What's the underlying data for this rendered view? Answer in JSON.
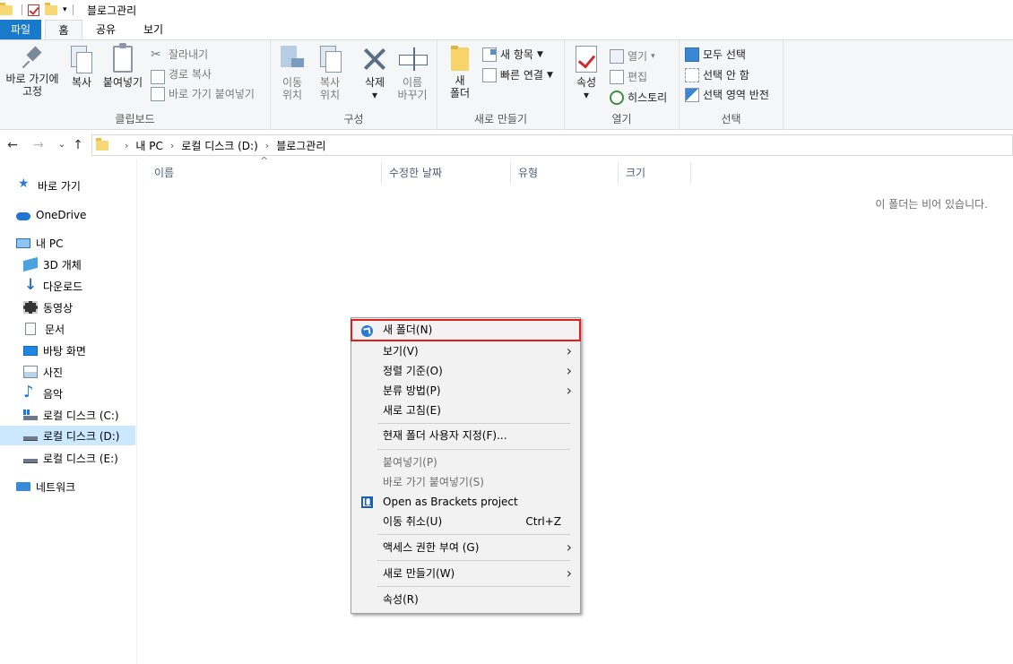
{
  "window": {
    "title": "블로그관리"
  },
  "tabs": {
    "file": "파일",
    "home": "홈",
    "share": "공유",
    "view": "보기"
  },
  "ribbon": {
    "clipboard": {
      "label": "클립보드",
      "pin_line1": "바로 가기에",
      "pin_line2": "고정",
      "copy": "복사",
      "paste": "붙여넣기",
      "cut": "잘라내기",
      "copy_path": "경로 복사",
      "paste_shortcut": "바로 가기 붙여넣기"
    },
    "organize": {
      "label": "구성",
      "move_line1": "이동",
      "move_line2": "위치",
      "copy_line1": "복사",
      "copy_line2": "위치",
      "delete": "삭제",
      "rename_line1": "이름",
      "rename_line2": "바꾸기"
    },
    "new": {
      "label": "새로 만들기",
      "new_folder_line1": "새",
      "new_folder_line2": "폴더",
      "new_item": "새 항목",
      "easy_access": "빠른 연결"
    },
    "open": {
      "label": "열기",
      "properties": "속성",
      "open": "열기",
      "edit": "편집",
      "history": "히스토리"
    },
    "select": {
      "label": "선택",
      "select_all": "모두 선택",
      "select_none": "선택 안 함",
      "invert": "선택 영역 반전"
    }
  },
  "address": {
    "crumbs": [
      "내 PC",
      "로컬 디스크 (D:)",
      "블로그관리"
    ]
  },
  "sidebar": {
    "items": [
      {
        "label": "바로 가기",
        "icon": "star-icon"
      },
      {
        "label": "OneDrive",
        "icon": "cloud-icon"
      },
      {
        "label": "내 PC",
        "icon": "computer-icon"
      },
      {
        "label": "3D 개체",
        "icon": "cube-icon"
      },
      {
        "label": "다운로드",
        "icon": "download-icon"
      },
      {
        "label": "동영상",
        "icon": "video-icon"
      },
      {
        "label": "문서",
        "icon": "document-icon"
      },
      {
        "label": "바탕 화면",
        "icon": "desktop-icon"
      },
      {
        "label": "사진",
        "icon": "picture-icon"
      },
      {
        "label": "음악",
        "icon": "music-icon"
      },
      {
        "label": "로컬 디스크 (C:)",
        "icon": "drive-icon"
      },
      {
        "label": "로컬 디스크 (D:)",
        "icon": "drive-icon",
        "selected": true
      },
      {
        "label": "로컬 디스크 (E:)",
        "icon": "drive-icon"
      },
      {
        "label": "네트워크",
        "icon": "network-icon"
      }
    ]
  },
  "columns": [
    "이름",
    "수정한 날짜",
    "유형",
    "크기"
  ],
  "empty_message": "이 폴더는 비어 있습니다.",
  "context_menu": {
    "items": [
      {
        "label": "새 폴더(N)",
        "highlighted": true,
        "icon": "new-folder-icon"
      },
      {
        "label": "보기(V)",
        "submenu": true
      },
      {
        "label": "정렬 기준(O)",
        "submenu": true
      },
      {
        "label": "분류 방법(P)",
        "submenu": true
      },
      {
        "label": "새로 고침(E)"
      },
      {
        "label": "현재 폴더 사용자 지정(F)..."
      },
      {
        "label": "붙여넣기(P)",
        "disabled": true
      },
      {
        "label": "바로 가기 붙여넣기(S)",
        "disabled": true
      },
      {
        "label": "Open as Brackets project",
        "icon": "brackets-icon"
      },
      {
        "label": "이동 취소(U)",
        "shortcut": "Ctrl+Z"
      },
      {
        "label": "액세스 권한 부여 (G)",
        "submenu": true
      },
      {
        "label": "새로 만들기(W)",
        "submenu": true
      },
      {
        "label": "속성(R)"
      }
    ]
  },
  "colors": {
    "file_tab": "#1979ca",
    "highlight_border": "#e31c1c",
    "selection": "#cce8ff"
  }
}
